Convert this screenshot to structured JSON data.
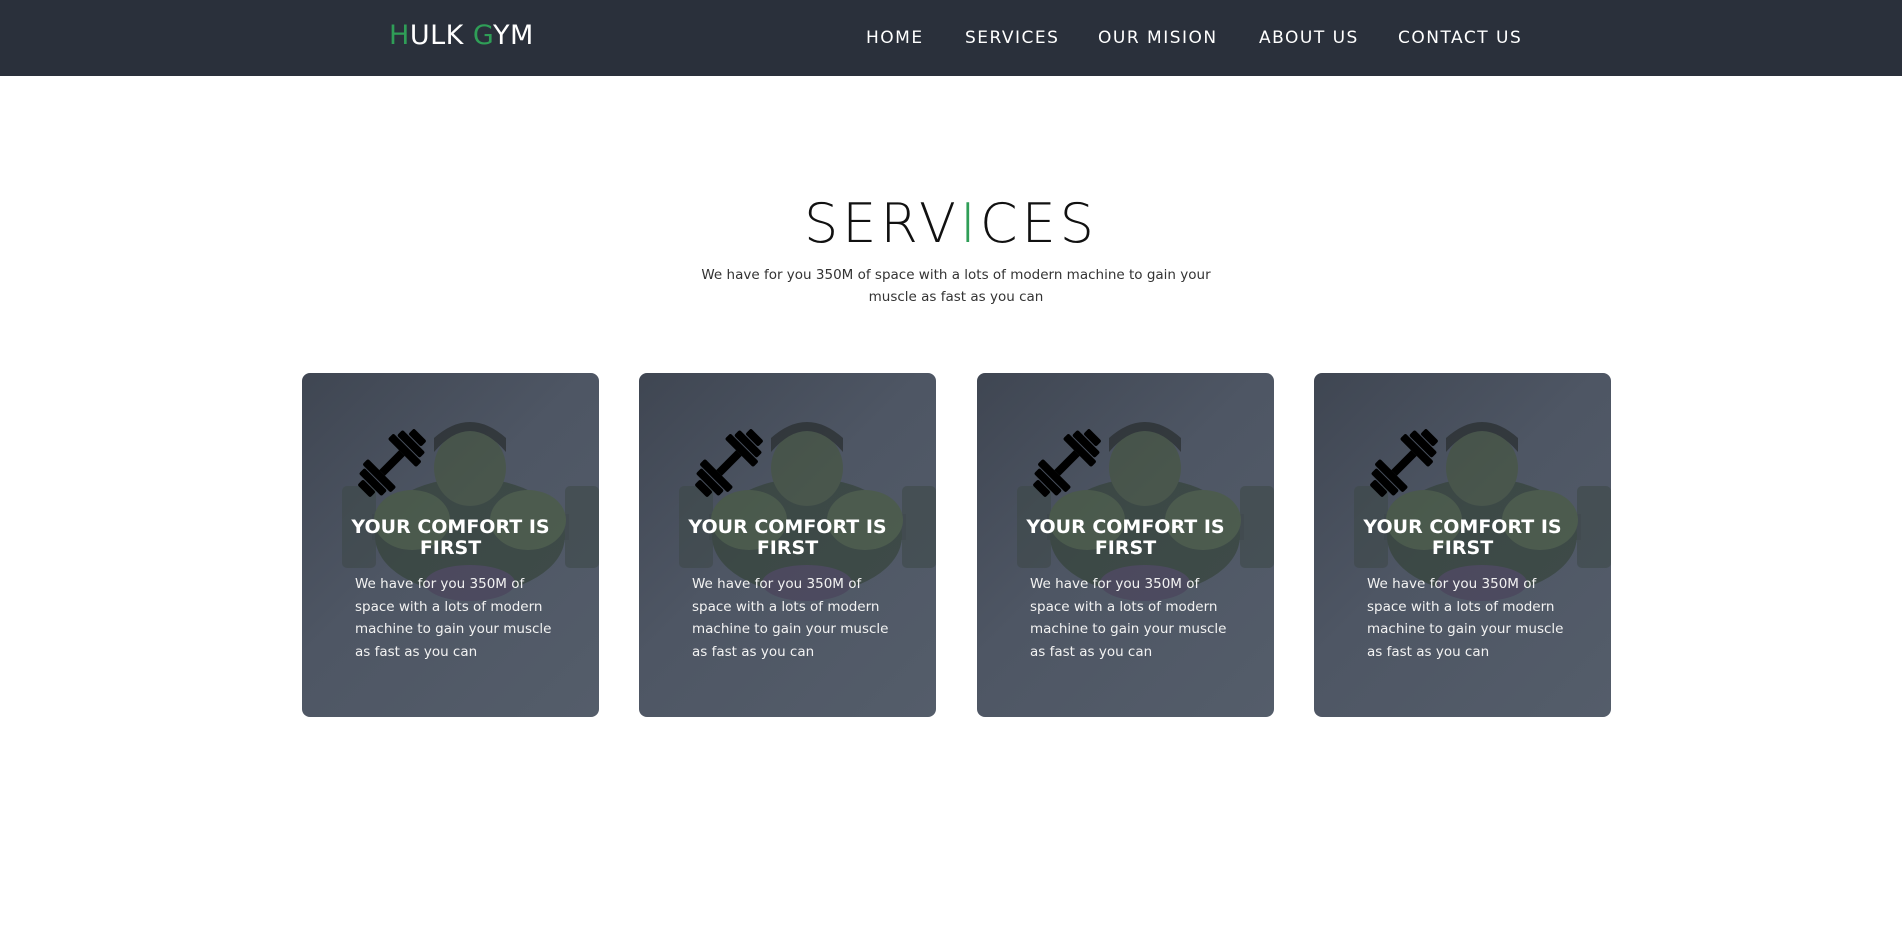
{
  "header": {
    "logo": {
      "first_initial": "H",
      "first_rest": "ULK",
      "second_initial": "G",
      "second_rest": "YM"
    },
    "nav": [
      "HOME",
      "SERVICES",
      "OUR MISION",
      "ABOUT US",
      "CONTACT US"
    ]
  },
  "services": {
    "title_before": "SERV",
    "title_accent": "I",
    "title_after": "CES",
    "subtitle": "We have for you 350M of space with a lots of modern machine to gain your muscle as fast as you can",
    "cards": [
      {
        "icon": "dumbbell-icon",
        "title": "YOUR COMFORT IS FIRST",
        "text": "We have for you 350M of space with a lots of modern machine to gain your muscle as fast as you can"
      },
      {
        "icon": "dumbbell-icon",
        "title": "YOUR COMFORT IS FIRST",
        "text": "We have for you 350M of space with a lots of modern machine to gain your muscle as fast as you can"
      },
      {
        "icon": "dumbbell-icon",
        "title": "YOUR COMFORT IS FIRST",
        "text": "We have for you 350M of space with a lots of modern machine to gain your muscle as fast as you can"
      },
      {
        "icon": "dumbbell-icon",
        "title": "YOUR COMFORT IS FIRST",
        "text": "We have for you 350M of space with a lots of modern machine to gain your muscle as fast as you can"
      }
    ]
  },
  "colors": {
    "accent": "#2f9e57",
    "navbar": "#2a303b",
    "card": "#4b5360"
  }
}
